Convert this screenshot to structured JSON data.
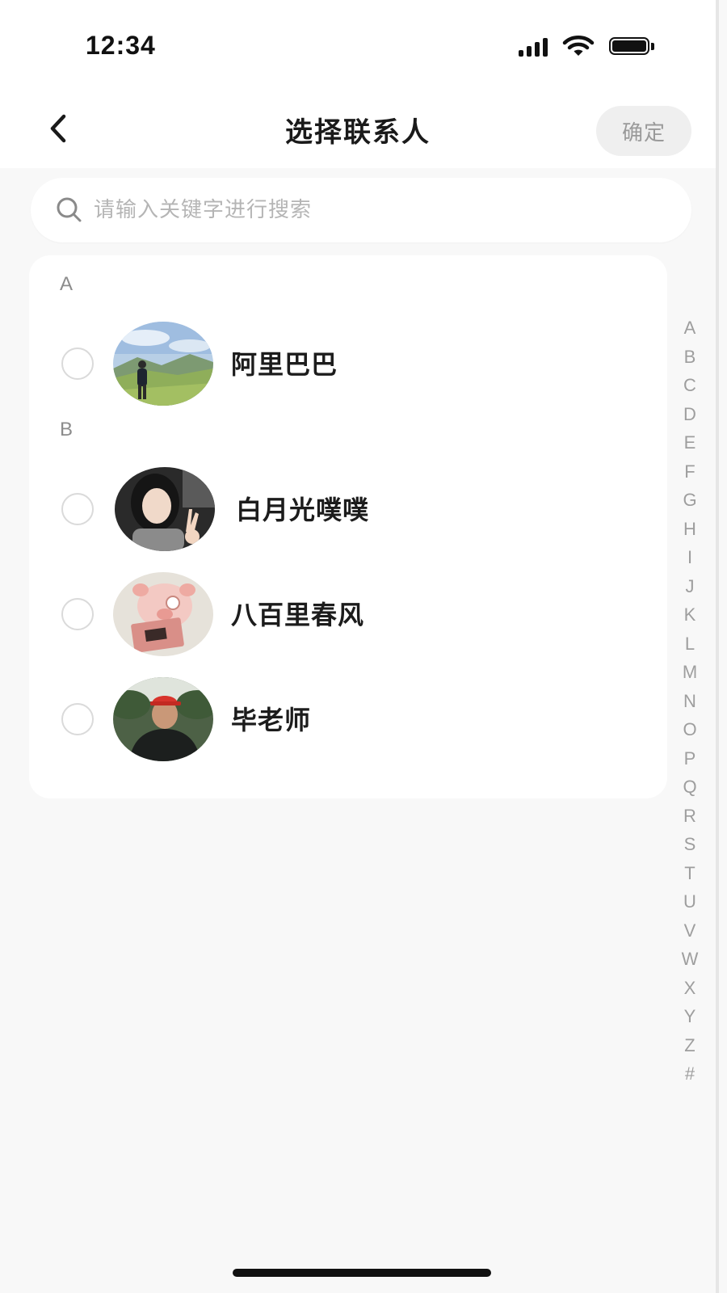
{
  "status_bar": {
    "time": "12:34",
    "icons": [
      "signal-icon",
      "wifi-icon",
      "battery-icon"
    ]
  },
  "header": {
    "back_icon": "chevron-left-icon",
    "title": "选择联系人",
    "confirm_label": "确定"
  },
  "search": {
    "icon": "search-icon",
    "placeholder": "请输入关键字进行搜索",
    "value": ""
  },
  "sections": [
    {
      "letter": "A",
      "contacts": [
        {
          "name": "阿里巴巴",
          "selected": false,
          "avatar": "person-on-hill-avatar"
        }
      ]
    },
    {
      "letter": "B",
      "contacts": [
        {
          "name": "白月光噗噗",
          "selected": false,
          "avatar": "girl-peace-sign-avatar"
        },
        {
          "name": "八百里春风",
          "selected": false,
          "avatar": "pig-plush-avatar"
        },
        {
          "name": "毕老师",
          "selected": false,
          "avatar": "man-red-cap-avatar"
        }
      ]
    }
  ],
  "index_letters": [
    "A",
    "B",
    "C",
    "D",
    "E",
    "F",
    "G",
    "H",
    "I",
    "J",
    "K",
    "L",
    "M",
    "N",
    "O",
    "P",
    "Q",
    "R",
    "S",
    "T",
    "U",
    "V",
    "W",
    "X",
    "Y",
    "Z",
    "#"
  ],
  "colors": {
    "background": "#f8f8f8",
    "card": "#ffffff",
    "title_text": "#1a1a1a",
    "muted_text": "#9e9e9e",
    "confirm_bg": "#efefef",
    "confirm_text": "#9a9a9a",
    "radio_border": "#dadada"
  }
}
